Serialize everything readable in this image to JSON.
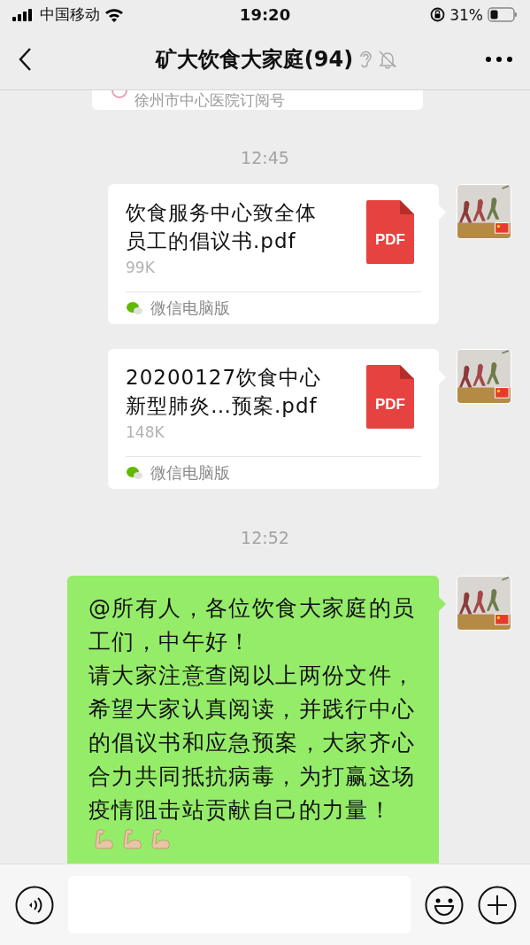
{
  "status_bar": {
    "carrier": "中国移动",
    "time": "19:20",
    "battery": "31%"
  },
  "header": {
    "title": "矿大饮食大家庭(94)"
  },
  "messages": [
    {
      "kind": "card",
      "text": "徐州市中心医院订阅号"
    },
    {
      "kind": "time",
      "text": "12:45"
    },
    {
      "kind": "file",
      "outgoing": true,
      "name": "饮食服务中心致全体员工的倡议书.pdf",
      "size": "99K",
      "file_type": "PDF",
      "source": "微信电脑版"
    },
    {
      "kind": "file",
      "outgoing": true,
      "name": "20200127饮食中心新型肺炎…预案.pdf",
      "size": "148K",
      "file_type": "PDF",
      "source": "微信电脑版"
    },
    {
      "kind": "time",
      "text": "12:52"
    },
    {
      "kind": "text",
      "outgoing": true,
      "paragraphs": [
        "@所有人，各位饮食大家庭的员工们，中午好！",
        "请大家注意查阅以上两份文件，希望大家认真阅读，并践行中心的倡议书和应急预案，大家齐心合力共同抵抗病毒，为打赢这场疫情阻击站贡献自己的力量！"
      ],
      "emojis": [
        {
          "kind": "flexed-arm"
        },
        {
          "kind": "flexed-arm"
        },
        {
          "kind": "flexed-arm"
        }
      ]
    }
  ]
}
